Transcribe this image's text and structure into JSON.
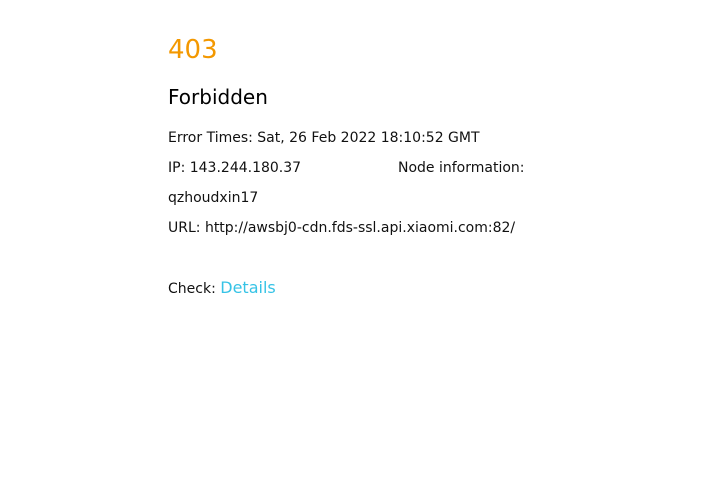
{
  "error": {
    "code": "403",
    "title": "Forbidden",
    "error_times": "Error Times: Sat, 26 Feb 2022 18:10:52 GMT",
    "ip": "IP: 143.244.180.37",
    "node_label": "Node information:",
    "node_value": "qzhoudxin17",
    "url": "URL: http://awsbj0-cdn.fds-ssl.api.xiaomi.com:82/",
    "check_label": "Check:",
    "details_link": "Details"
  },
  "colors": {
    "code": "#f39800",
    "link": "#36c3e6",
    "text": "#111111",
    "background": "#ffffff"
  }
}
